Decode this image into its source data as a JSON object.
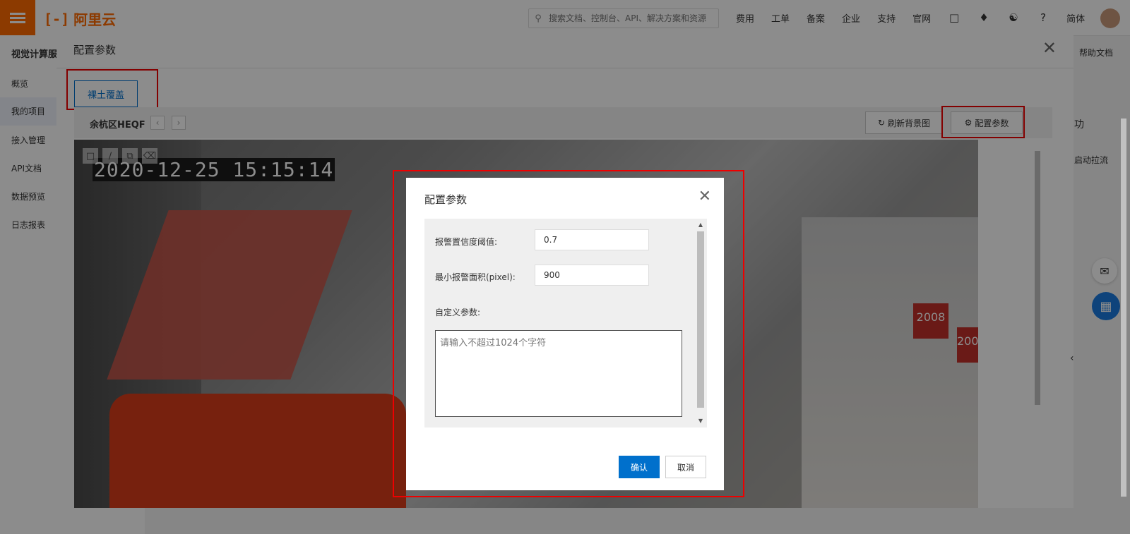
{
  "brand": {
    "mark": "[-]",
    "name": "阿里云"
  },
  "search": {
    "placeholder": "搜索文档、控制台、API、解决方案和资源"
  },
  "nav": {
    "links": [
      "费用",
      "工单",
      "备案",
      "企业",
      "支持",
      "官网"
    ],
    "lang": "简体"
  },
  "sidebar": {
    "title": "视觉计算服务",
    "items": [
      "概览",
      "我的项目",
      "接入管理",
      "API文档",
      "数据预览",
      "日志报表"
    ]
  },
  "right": {
    "help": "帮助文档",
    "b": "功",
    "c": "启动拉流"
  },
  "outer_dialog": {
    "title": "配置参数",
    "tab": "裸土覆盖",
    "device": "余杭区HEQF",
    "refresh_label": "刷新背景图",
    "config_label": "配置参数",
    "timestamp": "2020-12-25 15:15:14",
    "sign1": "2008",
    "sign2": "200"
  },
  "inner_dialog": {
    "title": "配置参数",
    "threshold_label": "报警置信度阈值:",
    "threshold_value": "0.7",
    "min_area_label": "最小报警面积(pixel):",
    "min_area_value": "900",
    "custom_label": "自定义参数:",
    "custom_placeholder": "请输入不超过1024个字符",
    "ok_label": "确认",
    "cancel_label": "取消"
  },
  "colors": {
    "accent": "#ff6a00",
    "primary": "#0070cc",
    "highlight": "#ee0000"
  }
}
